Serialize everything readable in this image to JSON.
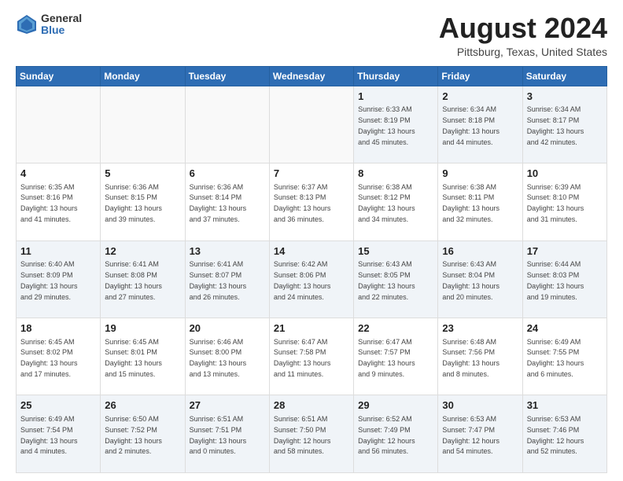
{
  "header": {
    "logo_general": "General",
    "logo_blue": "Blue",
    "main_title": "August 2024",
    "subtitle": "Pittsburg, Texas, United States"
  },
  "calendar": {
    "days_of_week": [
      "Sunday",
      "Monday",
      "Tuesday",
      "Wednesday",
      "Thursday",
      "Friday",
      "Saturday"
    ],
    "weeks": [
      [
        {
          "day": "",
          "info": "",
          "empty": true
        },
        {
          "day": "",
          "info": "",
          "empty": true
        },
        {
          "day": "",
          "info": "",
          "empty": true
        },
        {
          "day": "",
          "info": "",
          "empty": true
        },
        {
          "day": "1",
          "info": "Sunrise: 6:33 AM\nSunset: 8:19 PM\nDaylight: 13 hours\nand 45 minutes."
        },
        {
          "day": "2",
          "info": "Sunrise: 6:34 AM\nSunset: 8:18 PM\nDaylight: 13 hours\nand 44 minutes."
        },
        {
          "day": "3",
          "info": "Sunrise: 6:34 AM\nSunset: 8:17 PM\nDaylight: 13 hours\nand 42 minutes."
        }
      ],
      [
        {
          "day": "4",
          "info": "Sunrise: 6:35 AM\nSunset: 8:16 PM\nDaylight: 13 hours\nand 41 minutes."
        },
        {
          "day": "5",
          "info": "Sunrise: 6:36 AM\nSunset: 8:15 PM\nDaylight: 13 hours\nand 39 minutes."
        },
        {
          "day": "6",
          "info": "Sunrise: 6:36 AM\nSunset: 8:14 PM\nDaylight: 13 hours\nand 37 minutes."
        },
        {
          "day": "7",
          "info": "Sunrise: 6:37 AM\nSunset: 8:13 PM\nDaylight: 13 hours\nand 36 minutes."
        },
        {
          "day": "8",
          "info": "Sunrise: 6:38 AM\nSunset: 8:12 PM\nDaylight: 13 hours\nand 34 minutes."
        },
        {
          "day": "9",
          "info": "Sunrise: 6:38 AM\nSunset: 8:11 PM\nDaylight: 13 hours\nand 32 minutes."
        },
        {
          "day": "10",
          "info": "Sunrise: 6:39 AM\nSunset: 8:10 PM\nDaylight: 13 hours\nand 31 minutes."
        }
      ],
      [
        {
          "day": "11",
          "info": "Sunrise: 6:40 AM\nSunset: 8:09 PM\nDaylight: 13 hours\nand 29 minutes."
        },
        {
          "day": "12",
          "info": "Sunrise: 6:41 AM\nSunset: 8:08 PM\nDaylight: 13 hours\nand 27 minutes."
        },
        {
          "day": "13",
          "info": "Sunrise: 6:41 AM\nSunset: 8:07 PM\nDaylight: 13 hours\nand 26 minutes."
        },
        {
          "day": "14",
          "info": "Sunrise: 6:42 AM\nSunset: 8:06 PM\nDaylight: 13 hours\nand 24 minutes."
        },
        {
          "day": "15",
          "info": "Sunrise: 6:43 AM\nSunset: 8:05 PM\nDaylight: 13 hours\nand 22 minutes."
        },
        {
          "day": "16",
          "info": "Sunrise: 6:43 AM\nSunset: 8:04 PM\nDaylight: 13 hours\nand 20 minutes."
        },
        {
          "day": "17",
          "info": "Sunrise: 6:44 AM\nSunset: 8:03 PM\nDaylight: 13 hours\nand 19 minutes."
        }
      ],
      [
        {
          "day": "18",
          "info": "Sunrise: 6:45 AM\nSunset: 8:02 PM\nDaylight: 13 hours\nand 17 minutes."
        },
        {
          "day": "19",
          "info": "Sunrise: 6:45 AM\nSunset: 8:01 PM\nDaylight: 13 hours\nand 15 minutes."
        },
        {
          "day": "20",
          "info": "Sunrise: 6:46 AM\nSunset: 8:00 PM\nDaylight: 13 hours\nand 13 minutes."
        },
        {
          "day": "21",
          "info": "Sunrise: 6:47 AM\nSunset: 7:58 PM\nDaylight: 13 hours\nand 11 minutes."
        },
        {
          "day": "22",
          "info": "Sunrise: 6:47 AM\nSunset: 7:57 PM\nDaylight: 13 hours\nand 9 minutes."
        },
        {
          "day": "23",
          "info": "Sunrise: 6:48 AM\nSunset: 7:56 PM\nDaylight: 13 hours\nand 8 minutes."
        },
        {
          "day": "24",
          "info": "Sunrise: 6:49 AM\nSunset: 7:55 PM\nDaylight: 13 hours\nand 6 minutes."
        }
      ],
      [
        {
          "day": "25",
          "info": "Sunrise: 6:49 AM\nSunset: 7:54 PM\nDaylight: 13 hours\nand 4 minutes."
        },
        {
          "day": "26",
          "info": "Sunrise: 6:50 AM\nSunset: 7:52 PM\nDaylight: 13 hours\nand 2 minutes."
        },
        {
          "day": "27",
          "info": "Sunrise: 6:51 AM\nSunset: 7:51 PM\nDaylight: 13 hours\nand 0 minutes."
        },
        {
          "day": "28",
          "info": "Sunrise: 6:51 AM\nSunset: 7:50 PM\nDaylight: 12 hours\nand 58 minutes."
        },
        {
          "day": "29",
          "info": "Sunrise: 6:52 AM\nSunset: 7:49 PM\nDaylight: 12 hours\nand 56 minutes."
        },
        {
          "day": "30",
          "info": "Sunrise: 6:53 AM\nSunset: 7:47 PM\nDaylight: 12 hours\nand 54 minutes."
        },
        {
          "day": "31",
          "info": "Sunrise: 6:53 AM\nSunset: 7:46 PM\nDaylight: 12 hours\nand 52 minutes."
        }
      ]
    ]
  }
}
